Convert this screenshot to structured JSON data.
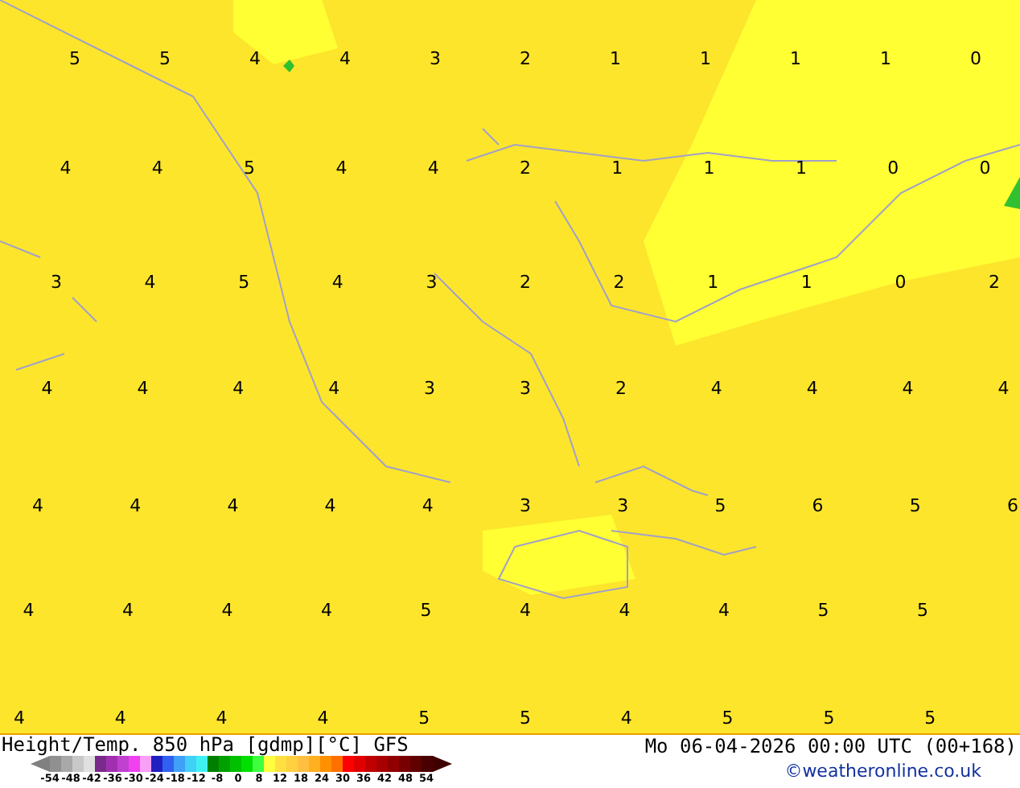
{
  "map": {
    "rows": [
      [
        "5",
        "5",
        "4",
        "4",
        "3",
        "2",
        "1",
        "1",
        "1",
        "1",
        "0"
      ],
      [
        "4",
        "4",
        "5",
        "4",
        "4",
        "2",
        "1",
        "1",
        "1",
        "0",
        "0"
      ],
      [
        "3",
        "4",
        "5",
        "4",
        "3",
        "2",
        "2",
        "1",
        "1",
        "0",
        "2"
      ],
      [
        "4",
        "4",
        "4",
        "4",
        "3",
        "3",
        "2",
        "4",
        "4",
        "4",
        "4"
      ],
      [
        "4",
        "4",
        "4",
        "4",
        "4",
        "3",
        "3",
        "5",
        "6",
        "5",
        "6"
      ],
      [
        "4",
        "4",
        "4",
        "4",
        "5",
        "4",
        "4",
        "4",
        "5",
        "5"
      ],
      [
        "4",
        "4",
        "4",
        "4",
        "5",
        "5",
        "4",
        "5",
        "5",
        "5"
      ]
    ]
  },
  "footer": {
    "title": "Height/Temp. 850 hPa [gdmp][°C] GFS",
    "datetime": "Mo 06-04-2026 00:00 UTC (00+168)",
    "credit": "©weatheronline.co.uk",
    "legend": {
      "colors": [
        {
          "color": "#909090"
        },
        {
          "color": "#a8a8a8"
        },
        {
          "color": "#c8c8c8"
        },
        {
          "color": "#e0e0e0"
        },
        {
          "color": "#7a2a8a"
        },
        {
          "color": "#a030b0"
        },
        {
          "color": "#c040d0"
        },
        {
          "color": "#f040f0"
        },
        {
          "color": "#f8a0f8"
        },
        {
          "color": "#2020c0"
        },
        {
          "color": "#3060f0"
        },
        {
          "color": "#40a0f8"
        },
        {
          "color": "#40d0f8"
        },
        {
          "color": "#40f0f0"
        },
        {
          "color": "#008000"
        },
        {
          "color": "#00a000"
        },
        {
          "color": "#00c000"
        },
        {
          "color": "#00e000"
        },
        {
          "color": "#40ff40"
        },
        {
          "color": "#ffff40"
        },
        {
          "color": "#ffe040"
        },
        {
          "color": "#ffd040"
        },
        {
          "color": "#ffc040"
        },
        {
          "color": "#ffb020"
        },
        {
          "color": "#ff9000"
        },
        {
          "color": "#ff7000"
        },
        {
          "color": "#ff0000"
        },
        {
          "color": "#e00000"
        },
        {
          "color": "#c00000"
        },
        {
          "color": "#a80000"
        },
        {
          "color": "#900000"
        },
        {
          "color": "#780000"
        },
        {
          "color": "#600000"
        },
        {
          "color": "#480000"
        }
      ],
      "ticks": [
        "-54",
        "-48",
        "-42",
        "-36",
        "-30",
        "-24",
        "-18",
        "-12",
        "-8",
        "0",
        "8",
        "12",
        "18",
        "24",
        "30",
        "36",
        "42",
        "48",
        "54"
      ]
    }
  }
}
